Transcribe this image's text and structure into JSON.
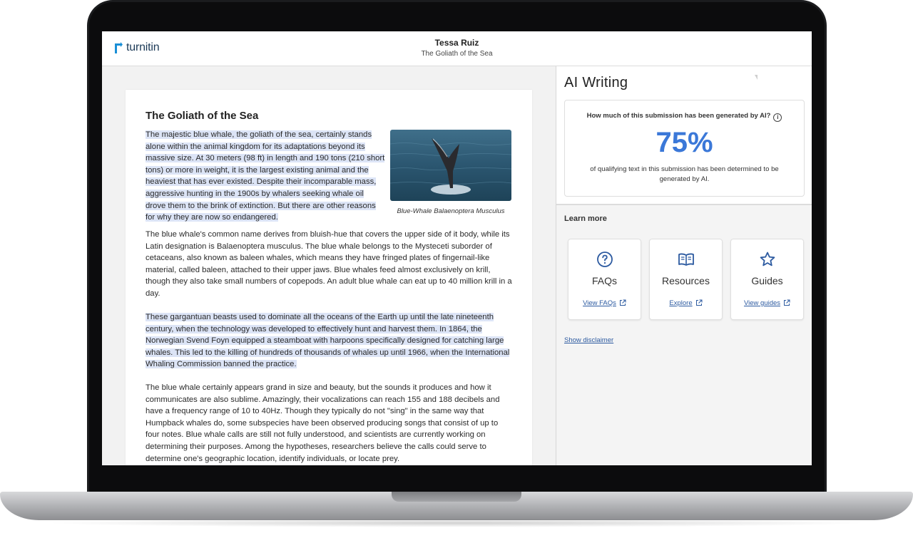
{
  "header": {
    "logo_text": "turnitin",
    "student_name": "Tessa Ruiz",
    "document_title": "The Goliath of the Sea"
  },
  "document": {
    "heading": "The Goliath of the Sea",
    "paragraphs": [
      "The majestic blue whale, the goliath of the sea, certainly stands alone within the animal kingdom for its adaptations beyond its massive size. At 30 meters (98 ft) in length and 190 tons (210 short tons) or more in weight, it is the largest existing animal and the heaviest that has ever existed. Despite their incomparable mass, aggressive hunting in the 1900s by whalers seeking whale oil drove them to the brink of extinction. But there are other reasons for why they are now so endangered.",
      "The blue whale's common name derives from bluish-hue that covers the upper side of it body, while its Latin designation is Balaenoptera musculus. The blue whale belongs to the Mysteceti suborder of cetaceans, also known as baleen whales, which means they have fringed plates of fingernail-like material, called baleen, attached to their upper jaws. Blue whales feed almost exclusively on krill, though they also take small numbers of copepods. An adult blue whale can eat up to 40 million krill in a day.",
      "These gargantuan beasts used to dominate all the oceans of the Earth up until the late nineteenth century, when the technology was developed to effectively hunt and harvest them. In 1864, the Norwegian Svend Foyn equipped a steamboat with harpoons specifically designed for catching large whales. This led to the killing of hundreds of thousands of whales up until 1966, when the International Whaling Commission banned the practice.",
      "The blue whale certainly appears grand in size and beauty, but the sounds it produces and how it communicates are also sublime. Amazingly, their vocalizations can reach 155 and 188 decibels and have a frequency range of 10 to 40Hz. Though they typically do not \"sing\" in the same way that Humpback whales do, some subspecies have been observed producing songs that consist of up to four notes. Blue whale calls are still not fully understood, and scientists are currently working on determining their purposes. Among the hypotheses, researchers believe the calls could serve to determine one's geographic location, identify individuals, or locate prey."
    ],
    "image_caption": "Blue-Whale Balaenoptera Musculus"
  },
  "ai_panel": {
    "title": "AI Writing",
    "question": "How much of this submission has been generated by AI?",
    "score": "75%",
    "score_description": "of qualifying text in this submission has been determined to be generated by AI.",
    "learn_more_label": "Learn more",
    "cards": [
      {
        "title": "FAQs",
        "link": "View FAQs",
        "icon": "question-circle-icon"
      },
      {
        "title": "Resources",
        "link": "Explore",
        "icon": "open-book-icon"
      },
      {
        "title": "Guides",
        "link": "View guides",
        "icon": "star-outline-icon"
      }
    ],
    "disclaimer_link": "Show disclaimer"
  },
  "colors": {
    "accent": "#3b78d8",
    "link": "#2c5aa0",
    "highlight": "#dce4f6",
    "logo": "#1c3a57"
  }
}
